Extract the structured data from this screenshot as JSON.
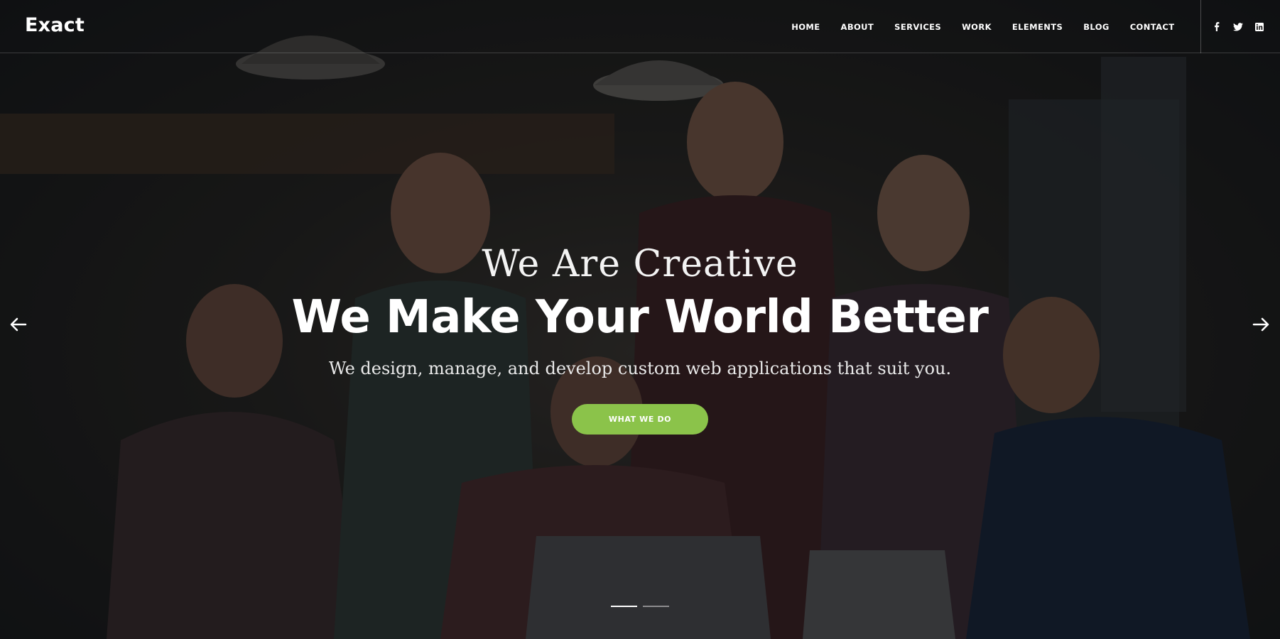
{
  "brand": {
    "logo": "Exact"
  },
  "nav": {
    "items": [
      {
        "label": "HOME"
      },
      {
        "label": "ABOUT"
      },
      {
        "label": "SERVICES"
      },
      {
        "label": "WORK"
      },
      {
        "label": "ELEMENTS"
      },
      {
        "label": "BLOG"
      },
      {
        "label": "CONTACT"
      }
    ]
  },
  "social": [
    {
      "icon": "facebook-icon"
    },
    {
      "icon": "twitter-icon"
    },
    {
      "icon": "linkedin-icon"
    }
  ],
  "hero": {
    "tagline": "We Are Creative",
    "headline": "We Make Your World Better",
    "subline": "We design, manage, and develop custom web applications that suit you.",
    "cta_label": "WHAT WE DO",
    "cta_color": "#8bc34a"
  },
  "slider": {
    "slide_count": 2,
    "active_index": 0,
    "prev_icon": "arrow-left-icon",
    "next_icon": "arrow-right-icon"
  }
}
